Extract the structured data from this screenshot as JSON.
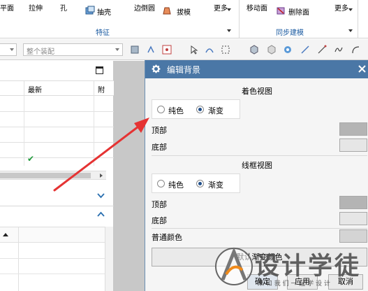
{
  "ribbon": {
    "items": [
      "平面",
      "拉伸",
      "孔",
      "抽壳",
      "边倒圆",
      "拔模",
      "更多",
      "移动面",
      "删除面",
      "更多"
    ],
    "groups": [
      "特征",
      "同步建模"
    ]
  },
  "toolbar": {
    "assembly_placeholder": "整个装配"
  },
  "navigator": {
    "columns": [
      "最新",
      "附"
    ],
    "checkmark": "✔",
    "colors": {
      "check": "#1f9a3a",
      "chevron": "#2a6fb0"
    }
  },
  "dialog": {
    "title": "编辑背景",
    "shaded": {
      "title": "着色视图",
      "options": [
        "纯色",
        "渐变"
      ],
      "selected": "渐变",
      "top_label": "顶部",
      "bottom_label": "底部"
    },
    "wireframe": {
      "title": "线框视图",
      "options": [
        "纯色",
        "渐变"
      ],
      "selected": "渐变",
      "top_label": "顶部",
      "bottom_label": "底部"
    },
    "plain_color_label": "普通颜色",
    "default_button": "默认渐变颜色",
    "buttons": [
      "确定",
      "应用",
      "取消"
    ],
    "colors": {
      "title_bar": "#4a77a6",
      "shaded_top": "#b4b4b4",
      "shaded_bottom": "#e6e6e6",
      "wire_top": "#b4b4b4",
      "wire_bottom": "#e6e6e6",
      "plain": "#d4d4d4"
    }
  },
  "watermark": {
    "text": "设计学徒",
    "subtitle": "来 和 我 们 一 起 学 设 计"
  },
  "annotation": {
    "color": "#e53333"
  }
}
